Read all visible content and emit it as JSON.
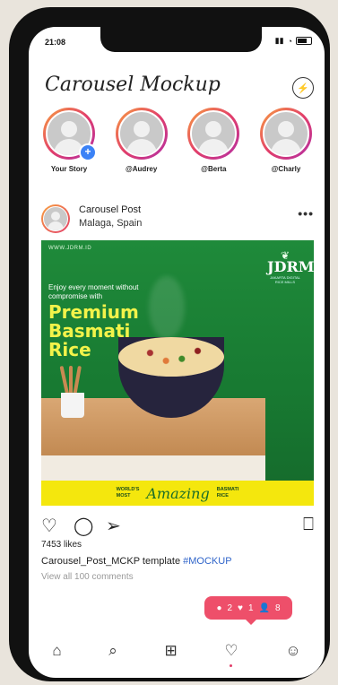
{
  "status": {
    "time": "21:08"
  },
  "header": {
    "title": "Carousel Mockup"
  },
  "stories": [
    {
      "label": "Your Story",
      "has_add": true
    },
    {
      "label": "@Audrey"
    },
    {
      "label": "@Berta"
    },
    {
      "label": "@Charly"
    }
  ],
  "post": {
    "user": "Carousel Post",
    "location": "Malaga, Spain",
    "image": {
      "url": "WWW.JDRM.ID",
      "brand": "JDRM",
      "brand_sub": "JAKARTA DIGITAL RICE MILLS",
      "tagline": "Enjoy every moment without compromise with",
      "headline_1": "Premium",
      "headline_2": "Basmati",
      "headline_3": "Rice",
      "banner_left_1": "WORLD'S",
      "banner_left_2": "MOST",
      "banner_center": "Amazing",
      "banner_right_1": "BASMATI",
      "banner_right_2": "RICE"
    },
    "likes": "7453 likes",
    "caption_text": "Carousel_Post_MCKP template ",
    "caption_tag": "#MOCKUP",
    "comments_link": "View all 100 comments"
  },
  "notifications": {
    "comments": "2",
    "likes": "1",
    "follows": "8"
  },
  "colors": {
    "accent": "#ee4f6a",
    "link": "#2f64c9",
    "banner": "#f4e70d"
  }
}
